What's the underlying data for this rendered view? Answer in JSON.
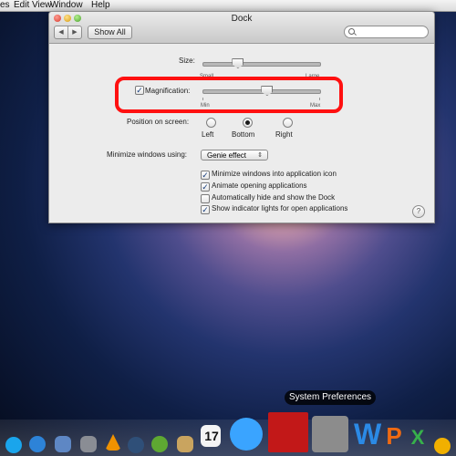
{
  "menubar": {
    "items": [
      "es",
      "Edit",
      "View",
      "Window",
      "Help"
    ]
  },
  "window": {
    "title": "Dock",
    "show_all": "Show All",
    "search_placeholder": "",
    "nav_back": "◀",
    "nav_forward": "▶"
  },
  "settings": {
    "size_label": "Size:",
    "size_min_label": "Small",
    "size_max_label": "Large",
    "size_value": 0.3,
    "magnification_label": "Magnification:",
    "magnification_checked": true,
    "magnification_min_label": "Min",
    "magnification_max_label": "Max",
    "magnification_value": 0.55,
    "position_label": "Position on screen:",
    "position_options": [
      "Left",
      "Bottom",
      "Right"
    ],
    "position_selected": "Bottom",
    "minimize_label": "Minimize windows using:",
    "minimize_value": "Genie effect",
    "checkboxes": [
      {
        "label": "Minimize windows into application icon",
        "checked": true
      },
      {
        "label": "Animate opening applications",
        "checked": true
      },
      {
        "label": "Automatically hide and show the Dock",
        "checked": false
      },
      {
        "label": "Show indicator lights for open applications",
        "checked": true
      }
    ],
    "help": "?"
  },
  "tooltip": "System Preferences",
  "dock": {
    "icons": [
      {
        "name": "skype-icon",
        "color": "#1aa5ec"
      },
      {
        "name": "safari-icon",
        "color": "#2d83d8"
      },
      {
        "name": "preview-icon",
        "color": "#5e87c4"
      },
      {
        "name": "network-utility-icon",
        "color": "#8a8d94"
      },
      {
        "name": "vlc-icon",
        "color": "#f09200"
      },
      {
        "name": "quicktime-icon",
        "color": "#2f4f78"
      },
      {
        "name": "utorrent-icon",
        "color": "#5ea832"
      },
      {
        "name": "notes-icon",
        "color": "#c9a45f"
      },
      {
        "name": "calendar-icon",
        "color": "#f4f4f4"
      },
      {
        "name": "itunes-icon",
        "color": "#3aa4ff"
      },
      {
        "name": "photo-booth-icon",
        "color": "#c21818"
      },
      {
        "name": "system-preferences-icon",
        "color": "#8c8c8c"
      },
      {
        "name": "word-icon",
        "color": "#2b8ae6"
      },
      {
        "name": "powerpoint-icon",
        "color": "#f06a12"
      },
      {
        "name": "excel-icon",
        "color": "#37b14b"
      },
      {
        "name": "misc-icon",
        "color": "#f1b000"
      }
    ],
    "calendar_day": "17",
    "word_glyph": "W",
    "powerpoint_glyph": "P",
    "excel_glyph": "X"
  }
}
